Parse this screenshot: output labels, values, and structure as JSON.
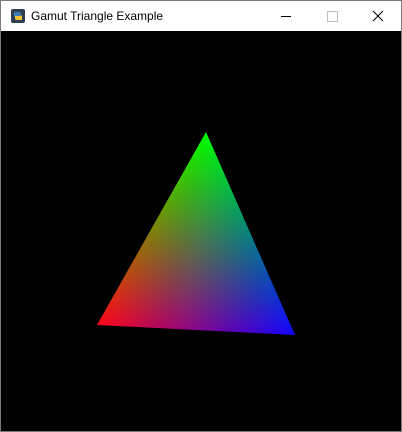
{
  "window": {
    "title": "Gamut Triangle Example",
    "icon": "python-icon",
    "controls": {
      "minimize_icon": "minimize-icon",
      "maximize_icon": "maximize-icon",
      "close_icon": "close-icon",
      "maximize_enabled": false
    }
  },
  "scene": {
    "background_color": "#000000",
    "triangle": {
      "vertex_colors": {
        "top": "#00ff00",
        "left": "#ff0000",
        "right": "#0000ff"
      }
    }
  }
}
